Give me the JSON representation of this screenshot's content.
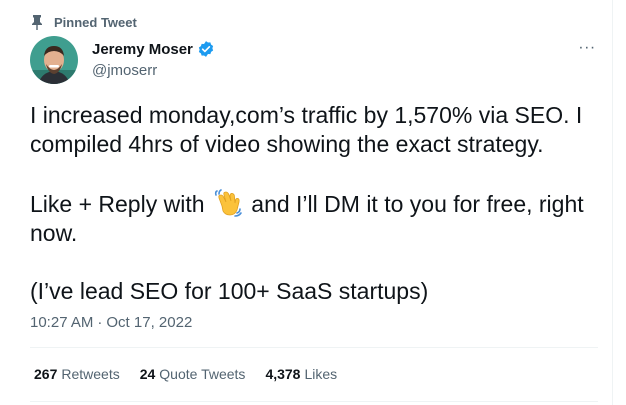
{
  "pinned_label": "Pinned Tweet",
  "author": {
    "name": "Jeremy Moser",
    "handle": "@jmoserr"
  },
  "more_label": "···",
  "tweet": {
    "line1": "I increased monday,com’s traffic by 1,570% via SEO. I compiled 4hrs of video showing the exact strategy.",
    "line2_before": "Like + Reply with",
    "line2_after": "and I’ll DM it to you for free, right now.",
    "line3": "(I’ve lead SEO for 100+ SaaS startups)"
  },
  "timestamp": {
    "time": "10:27 AM",
    "separator": "·",
    "date": "Oct 17, 2022"
  },
  "stats": {
    "retweets_count": "267",
    "retweets_label": "Retweets",
    "quotes_count": "24",
    "quotes_label": "Quote Tweets",
    "likes_count": "4,378",
    "likes_label": "Likes"
  },
  "colors": {
    "verified": "#1d9bf0",
    "secondary_text": "#536471",
    "primary_text": "#0f1419"
  },
  "icons": [
    "pin-icon",
    "verified-badge-icon",
    "more-icon",
    "waving-hand-emoji"
  ]
}
